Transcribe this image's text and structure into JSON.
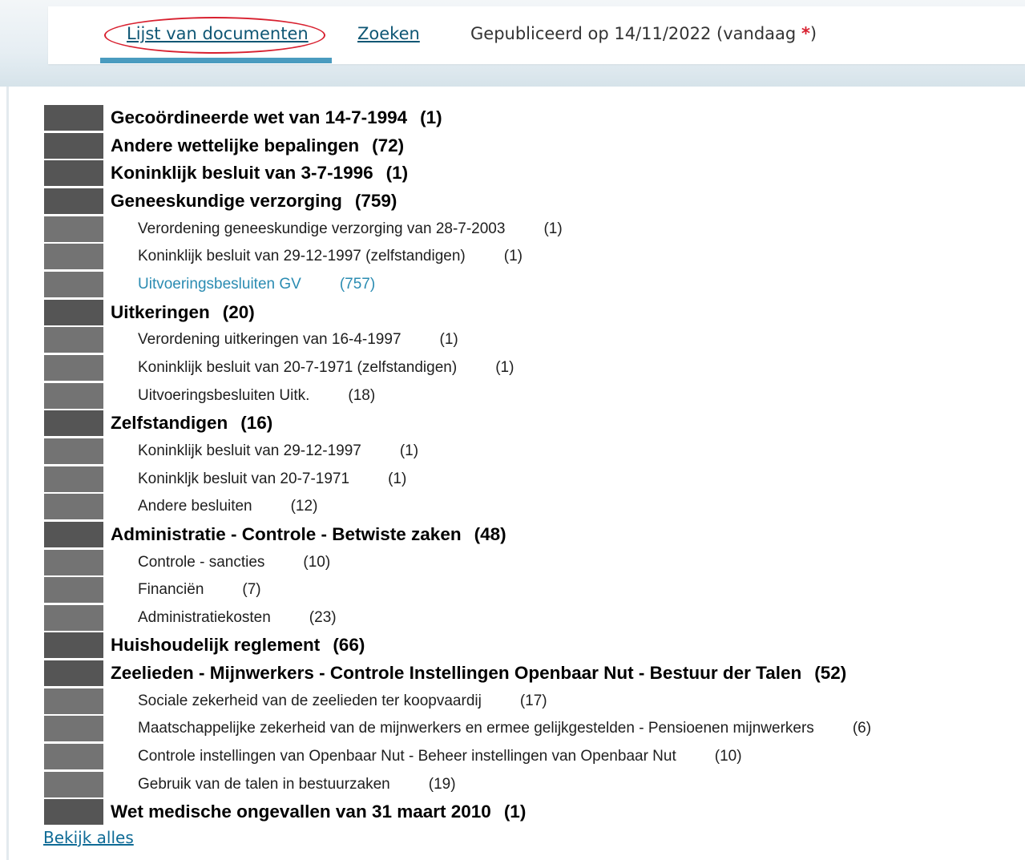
{
  "header": {
    "tabs": [
      {
        "label": "Lijst van documenten",
        "active": true
      },
      {
        "label": "Zoeken",
        "active": false
      }
    ],
    "published_text": "Gepubliceerd op 14/11/2022 (vandaag ",
    "published_star": "*",
    "published_close": ")"
  },
  "colors": {
    "accent": "#4a9bbf",
    "highlight_ellipse": "#d8202f",
    "active_item": "#2b8cb2",
    "link": "#0f6b96"
  },
  "documents": [
    {
      "level": "main",
      "title": "Gecoördineerde wet van 14-7-1994",
      "count": "(1)"
    },
    {
      "level": "main",
      "title": "Andere wettelijke bepalingen",
      "count": "(72)"
    },
    {
      "level": "main",
      "title": "Koninklijk besluit van 3-7-1996",
      "count": "(1)"
    },
    {
      "level": "main",
      "title": "Geneeskundige verzorging",
      "count": "(759)"
    },
    {
      "level": "sub",
      "title": "Verordening geneeskundige verzorging van 28-7-2003",
      "count": "(1)"
    },
    {
      "level": "sub",
      "title": "Koninklijk besluit van 29-12-1997 (zelfstandigen)",
      "count": "(1)"
    },
    {
      "level": "sub",
      "title": "Uitvoeringsbesluiten GV",
      "count": "(757)",
      "active": true
    },
    {
      "level": "main",
      "title": "Uitkeringen",
      "count": "(20)"
    },
    {
      "level": "sub",
      "title": "Verordening uitkeringen van 16-4-1997",
      "count": "(1)"
    },
    {
      "level": "sub",
      "title": "Koninklijk besluit van 20-7-1971 (zelfstandigen)",
      "count": "(1)"
    },
    {
      "level": "sub",
      "title": "Uitvoeringsbesluiten Uitk.",
      "count": "(18)"
    },
    {
      "level": "main",
      "title": "Zelfstandigen",
      "count": "(16)"
    },
    {
      "level": "sub",
      "title": "Koninklijk besluit van 29-12-1997",
      "count": "(1)"
    },
    {
      "level": "sub",
      "title": "Koninkljk besluit van 20-7-1971",
      "count": "(1)"
    },
    {
      "level": "sub",
      "title": "Andere besluiten",
      "count": "(12)"
    },
    {
      "level": "main",
      "title": "Administratie - Controle - Betwiste zaken",
      "count": "(48)"
    },
    {
      "level": "sub",
      "title": "Controle - sancties",
      "count": "(10)"
    },
    {
      "level": "sub",
      "title": "Financiën",
      "count": "(7)"
    },
    {
      "level": "sub",
      "title": "Administratiekosten",
      "count": "(23)"
    },
    {
      "level": "main",
      "title": "Huishoudelijk reglement",
      "count": "(66)"
    },
    {
      "level": "main",
      "title": "Zeelieden - Mijnwerkers - Controle Instellingen Openbaar Nut - Bestuur der Talen",
      "count": "(52)"
    },
    {
      "level": "sub",
      "title": "Sociale zekerheid van de zeelieden ter koopvaardij",
      "count": "(17)"
    },
    {
      "level": "sub",
      "title": "Maatschappelijke zekerheid van de mijnwerkers en ermee gelijkgestelden - Pensioenen mijnwerkers",
      "count": "(6)"
    },
    {
      "level": "sub",
      "title": "Controle instellingen van Openbaar Nut - Beheer instellingen van Openbaar Nut",
      "count": "(10)"
    },
    {
      "level": "sub",
      "title": "Gebruik van de talen in bestuurzaken",
      "count": "(19)"
    },
    {
      "level": "main",
      "title": "Wet medische ongevallen van 31 maart 2010",
      "count": "(1)"
    }
  ],
  "footer": {
    "see_all_label": "Bekijk alles"
  }
}
